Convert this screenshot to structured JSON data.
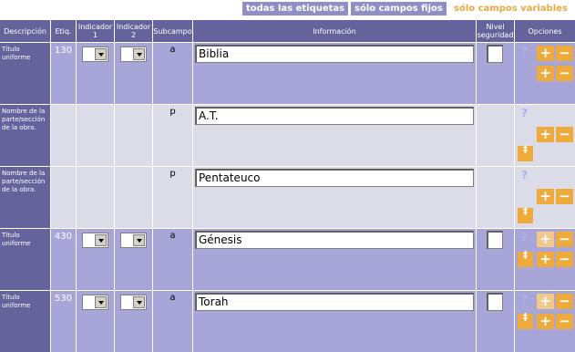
{
  "top_links": [
    "todas las etiquetas",
    "sólo campos fijos",
    "sólo campos variables"
  ],
  "headers": {
    "descripcion": "Descripción",
    "etiq": "Etiq.",
    "indicador1": "Indicador 1",
    "indicador2": "Indicador 2",
    "subcampo": "Subcampo",
    "informacion": "Información",
    "nivel": "Nivel seguridad",
    "opciones": "Opciones"
  },
  "rows": [
    {
      "desc": "Título uniforme",
      "etiq": "130",
      "sub": "a",
      "value": "Biblia",
      "type": "field"
    },
    {
      "desc": "Nombre de la parte/sección de la obra.",
      "etiq": "",
      "sub": "p",
      "value": "A.T.",
      "type": "sub"
    },
    {
      "desc": "Nombre de la parte/sección de la obra.",
      "etiq": "",
      "sub": "p",
      "value": "Pentateuco",
      "type": "sub"
    },
    {
      "desc": "Título uniforme",
      "etiq": "430",
      "sub": "a",
      "value": "Génesis",
      "type": "field"
    },
    {
      "desc": "Título uniforme",
      "etiq": "530",
      "sub": "a",
      "value": "Torah",
      "type": "field"
    }
  ],
  "icons": {
    "help": "?",
    "plus": "+",
    "minus": "−",
    "move": "‡"
  },
  "colors": {
    "header": "#65639b",
    "lavender": "#a8a6d8",
    "grey": "#dcdce8",
    "accent": "#eeaa3a"
  }
}
